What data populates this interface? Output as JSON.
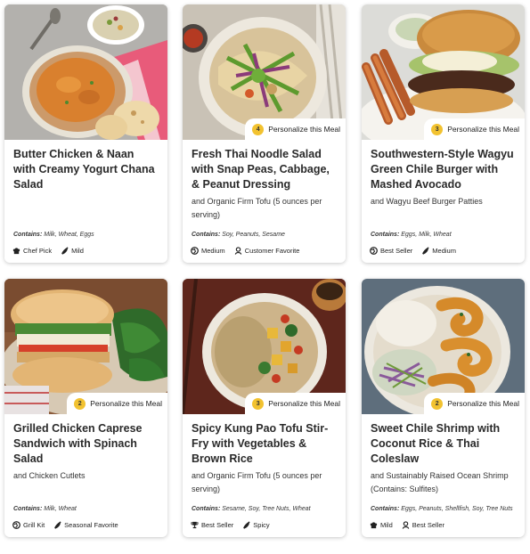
{
  "personalize_label": "Personalize this Meal",
  "contains_label": "Contains:",
  "cards": [
    {
      "title": "Butter Chicken & Naan with Creamy Yogurt Chana Salad",
      "subtitle": "",
      "contains": "Milk, Wheat, Eggs",
      "personalize_count": "",
      "badges": [
        {
          "label": "Chef Pick",
          "icon": "chef-hat-icon"
        },
        {
          "label": "Mild",
          "icon": "pepper-icon"
        }
      ]
    },
    {
      "title": "Fresh Thai Noodle Salad with Snap Peas, Cabbage, & Peanut Dressing",
      "subtitle": "and Organic Firm Tofu (5 ounces per serving)",
      "contains": "Soy, Peanuts, Sesame",
      "personalize_count": "4",
      "badges": [
        {
          "label": "Medium",
          "icon": "globe-icon"
        },
        {
          "label": "Customer Favorite",
          "icon": "customer-icon"
        }
      ]
    },
    {
      "title": "Southwestern-Style Wagyu Green Chile Burger with Mashed Avocado",
      "subtitle": "and Wagyu Beef Burger Patties",
      "contains": "Eggs, Milk, Wheat",
      "personalize_count": "3",
      "badges": [
        {
          "label": "Best Seller",
          "icon": "globe-icon"
        },
        {
          "label": "Medium",
          "icon": "pepper-icon"
        }
      ]
    },
    {
      "title": "Grilled Chicken Caprese Sandwich with Spinach Salad",
      "subtitle": "and Chicken Cutlets",
      "contains": "Milk, Wheat",
      "personalize_count": "2",
      "badges": [
        {
          "label": "Grill Kit",
          "icon": "globe-icon"
        },
        {
          "label": "Seasonal Favorite",
          "icon": "pepper-icon"
        }
      ]
    },
    {
      "title": "Spicy Kung Pao Tofu Stir-Fry with Vegetables & Brown Rice",
      "subtitle": "and Organic Firm Tofu (5 ounces per serving)",
      "contains": "Sesame, Soy, Tree Nuts, Wheat",
      "personalize_count": "3",
      "badges": [
        {
          "label": "Best Seller",
          "icon": "trophy-icon"
        },
        {
          "label": "Spicy",
          "icon": "pepper-icon"
        }
      ]
    },
    {
      "title": "Sweet Chile Shrimp with Coconut Rice & Thai Coleslaw",
      "subtitle": "and Sustainably Raised Ocean Shrimp (Contains: Sulfites)",
      "contains": "Eggs, Peanuts, Shellfish, Soy, Tree Nuts",
      "personalize_count": "2",
      "badges": [
        {
          "label": "Mild",
          "icon": "chef-hat-icon"
        },
        {
          "label": "Best Seller",
          "icon": "customer-icon"
        }
      ]
    }
  ]
}
